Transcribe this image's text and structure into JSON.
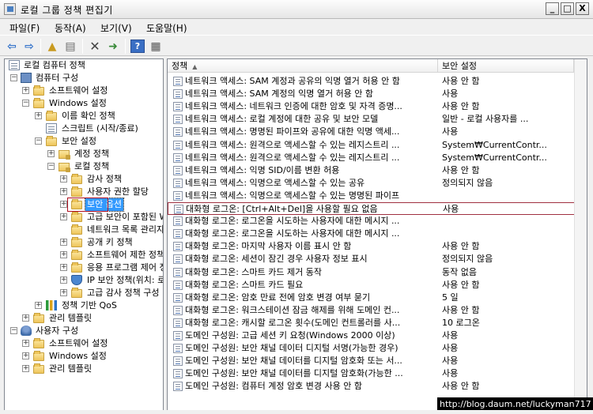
{
  "window": {
    "title": "로컬 그룹 정책 편집기",
    "min_label": "_",
    "max_label": "□",
    "close_label": "X"
  },
  "menu": [
    {
      "label": "파일(F)"
    },
    {
      "label": "동작(A)"
    },
    {
      "label": "보기(V)"
    },
    {
      "label": "도움말(H)"
    }
  ],
  "toolbar": {
    "icons": [
      "back-icon",
      "forward-icon",
      "up-folder-icon",
      "show-hide-tree-icon",
      "delete-icon",
      "export-list-icon",
      "help-icon",
      "properties-icon"
    ]
  },
  "tree": [
    {
      "label": "로컬 컴퓨터 정책",
      "icon": "doc"
    },
    {
      "label": "컴퓨터 구성",
      "icon": "pc",
      "expander": "−"
    },
    {
      "label": "소프트웨어 설정",
      "icon": "folder",
      "expander": "+"
    },
    {
      "label": "Windows 설정",
      "icon": "folder",
      "expander": "−"
    },
    {
      "label": "이름 확인 정책",
      "icon": "folder",
      "expander": "+"
    },
    {
      "label": "스크립트 (시작/종료)",
      "icon": "doc"
    },
    {
      "label": "보안 설정",
      "icon": "folder",
      "expander": "−"
    },
    {
      "label": "계정 정책",
      "icon": "lockfolder",
      "expander": "+"
    },
    {
      "label": "로컬 정책",
      "icon": "lockfolder",
      "expander": "−"
    },
    {
      "label": "감사 정책",
      "icon": "folder",
      "expander": "+"
    },
    {
      "label": "사용자 권한 할당",
      "icon": "folder",
      "expander": "+"
    },
    {
      "label": "보안 옵션",
      "icon": "folder",
      "selected": true
    },
    {
      "label": "고급 보안이 포함된 Windows 방화벽",
      "icon": "folder",
      "expander": "+"
    },
    {
      "label": "네트워크 목록 관리자 정책",
      "icon": "folder"
    },
    {
      "label": "공개 키 정책",
      "icon": "folder",
      "expander": "+"
    },
    {
      "label": "소프트웨어 제한 정책",
      "icon": "folder",
      "expander": "+"
    },
    {
      "label": "응용 프로그램 제어 정책",
      "icon": "folder",
      "expander": "+"
    },
    {
      "label": "IP 보안 정책(위치: 로컬 컴퓨터)",
      "icon": "shield",
      "expander": "+"
    },
    {
      "label": "고급 감사 정책 구성",
      "icon": "folder",
      "expander": "+"
    },
    {
      "label": "정책 기반 QoS",
      "icon": "qos",
      "expander": "+"
    },
    {
      "label": "관리 템플릿",
      "icon": "folder",
      "expander": "+"
    },
    {
      "label": "사용자 구성",
      "icon": "user",
      "expander": "−"
    },
    {
      "label": "소프트웨어 설정",
      "icon": "folder",
      "expander": "+"
    },
    {
      "label": "Windows 설정",
      "icon": "folder",
      "expander": "+"
    },
    {
      "label": "관리 템플릿",
      "icon": "folder",
      "expander": "+"
    }
  ],
  "list": {
    "columns": [
      "정책",
      "보안 설정"
    ],
    "sort_arrow": "▲",
    "rows": [
      [
        "네트워크 액세스: SAM 계정과 공유의 익명 열거 허용 안 함",
        "사용 안 함"
      ],
      [
        "네트워크 액세스: SAM 계정의 익명 열거 허용 안 함",
        "사용"
      ],
      [
        "네트워크 액세스: 네트워크 인증에 대한 암호 및 자격 증명...",
        "사용 안 함"
      ],
      [
        "네트워크 액세스: 로컬 계정에 대한 공유 및 보안 모델",
        "일반 - 로컬 사용자를 ..."
      ],
      [
        "네트워크 액세스: 명명된 파이프와 공유에 대한 익명 액세...",
        "사용"
      ],
      [
        "네트워크 액세스: 원격으로 액세스할 수 있는 레지스트리 ...",
        "System₩CurrentContr..."
      ],
      [
        "네트워크 액세스: 원격으로 액세스할 수 있는 레지스트리 ...",
        "System₩CurrentContr..."
      ],
      [
        "네트워크 액세스: 익명 SID/이름 변환 허용",
        "사용 안 함"
      ],
      [
        "네트워크 액세스: 익명으로 액세스할 수 있는 공유",
        "정의되지 않음"
      ],
      [
        "네트워크 액세스: 익명으로 액세스할 수 있는 명명된 파이프",
        ""
      ],
      [
        "대화형 로그온: [Ctrl+Alt+Del]을 사용할 필요 없음",
        "사용"
      ],
      [
        "대화형 로그온: 로그온을 시도하는 사용자에 대한 메시지 ...",
        ""
      ],
      [
        "대화형 로그온: 로그온을 시도하는 사용자에 대한 메시지 ...",
        ""
      ],
      [
        "대화형 로그온: 마지막 사용자 이름 표시 안 함",
        "사용 안 함"
      ],
      [
        "대화형 로그온: 세션이 잠긴 경우 사용자 정보 표시",
        "정의되지 않음"
      ],
      [
        "대화형 로그온: 스마트 카드 제거 동작",
        "동작 없음"
      ],
      [
        "대화형 로그온: 스마트 카드 필요",
        "사용 안 함"
      ],
      [
        "대화형 로그온: 암호 만료 전에 암호 변경 여부 묻기",
        "5 일"
      ],
      [
        "대화형 로그온: 워크스테이션 잠금 해제를 위해 도메인 컨...",
        "사용 안 함"
      ],
      [
        "대화형 로그온: 캐시할 로그온 횟수(도메인 컨트롤러를 사...",
        "10 로그온"
      ],
      [
        "도메인 구성원: 고급 세션 키 요청(Windows 2000 이상)",
        "사용"
      ],
      [
        "도메인 구성원: 보안 채널 데이터 디지털 서명(가능한 경우)",
        "사용"
      ],
      [
        "도메인 구성원: 보안 채널 데이터를 디지털 암호화 또는 서...",
        "사용"
      ],
      [
        "도메인 구성원: 보안 채널 데이터를 디지털 암호화(가능한 ...",
        "사용"
      ],
      [
        "도메인 구성원: 컴퓨터 계정 암호 변경 사용 안 함",
        "사용 안 함"
      ]
    ]
  },
  "watermark": "http://blog.daum.net/luckyman717"
}
